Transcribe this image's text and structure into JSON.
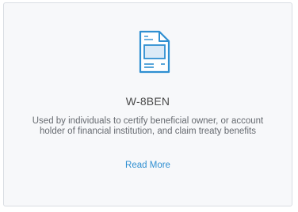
{
  "card": {
    "icon": "document-form-icon",
    "title": "W-8BEN",
    "description": "Used by individuals to certify beneficial owner, or account holder of financial institution, and claim treaty benefits",
    "link_label": "Read More"
  },
  "colors": {
    "accent": "#2f8fd1",
    "card_background": "#f7f8fa",
    "card_border": "#d9dde3",
    "text": "#4a4a4a"
  }
}
